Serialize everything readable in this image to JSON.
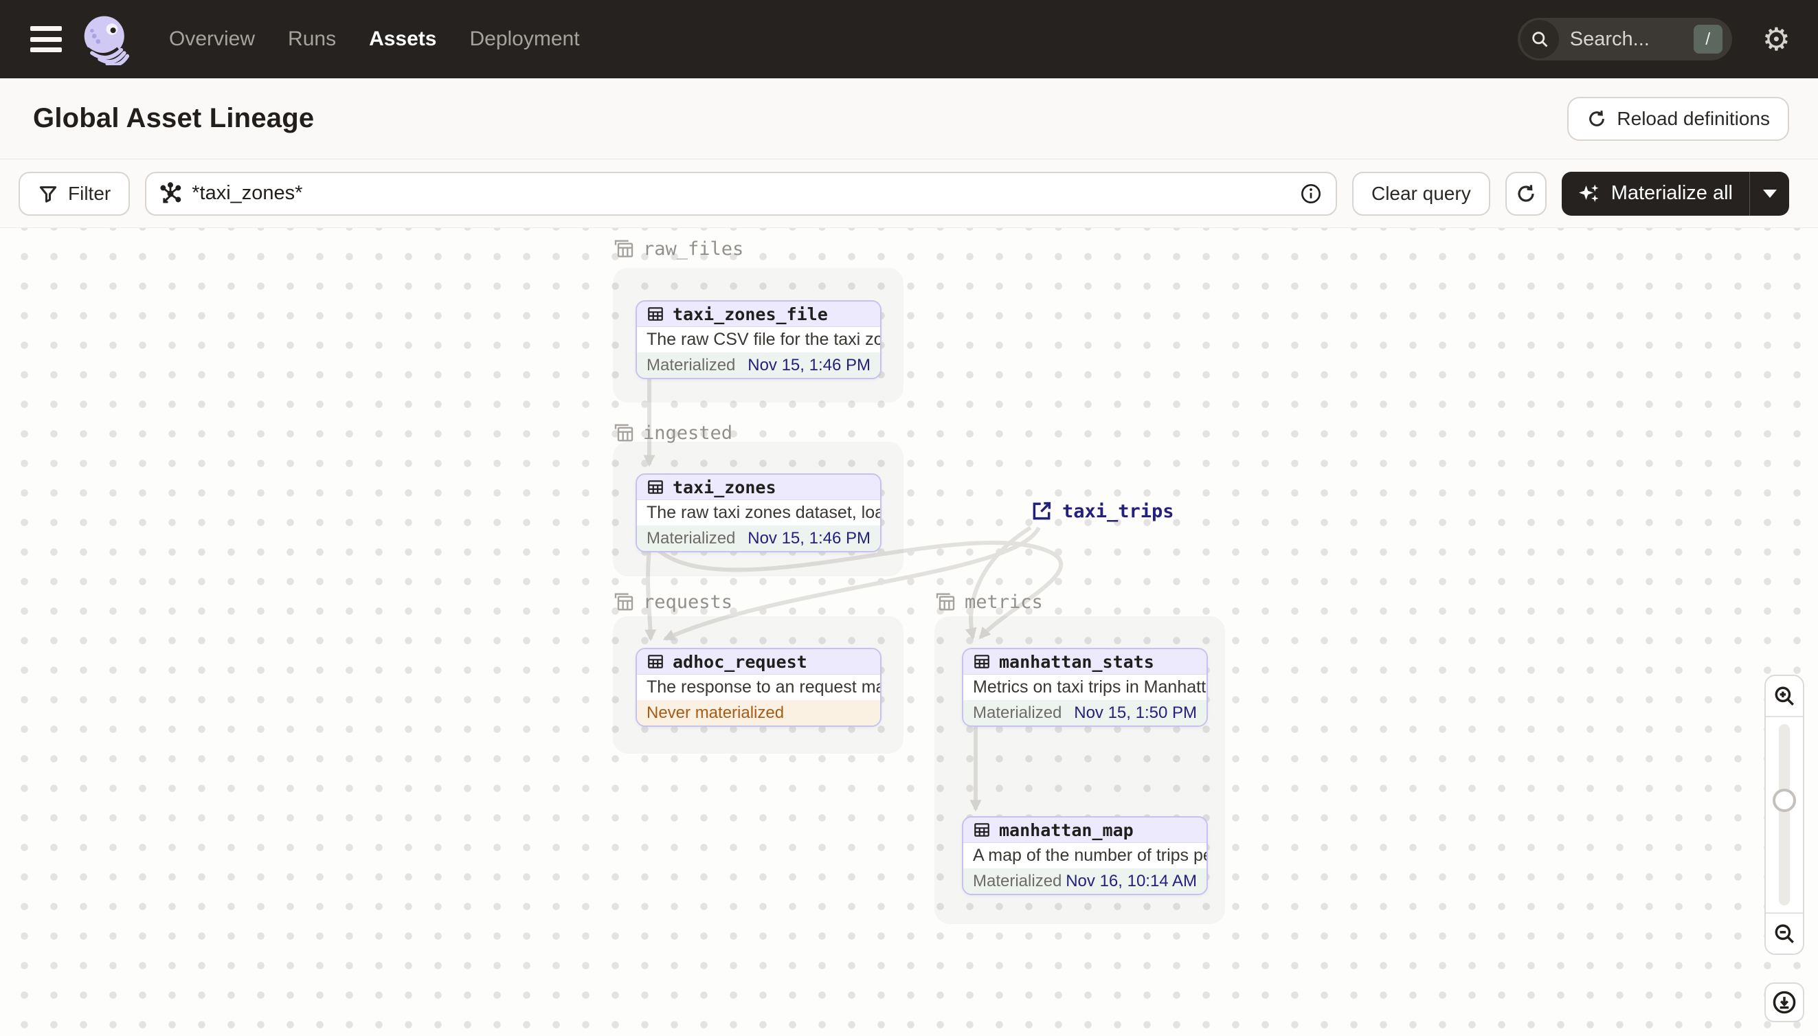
{
  "nav": {
    "items": {
      "overview": "Overview",
      "runs": "Runs",
      "assets": "Assets",
      "deployment": "Deployment"
    },
    "active_item": "Assets",
    "search_placeholder": "Search...",
    "search_shortcut": "/"
  },
  "header": {
    "title": "Global Asset Lineage",
    "reload_button": "Reload definitions"
  },
  "toolbar": {
    "filter_button": "Filter",
    "query_value": "*taxi_zones*",
    "clear_button": "Clear query",
    "materialize_button": "Materialize all"
  },
  "graph": {
    "groups": [
      "raw_files",
      "ingested",
      "requests",
      "metrics"
    ],
    "external_assets": [
      {
        "name": "taxi_trips"
      }
    ],
    "nodes": [
      {
        "name": "taxi_zones_file",
        "group": "raw_files",
        "description": "The raw CSV file for the taxi zones dat...",
        "status": "Materialized",
        "status_time": "Nov 15, 1:46 PM"
      },
      {
        "name": "taxi_zones",
        "group": "ingested",
        "description": "The raw taxi zones dataset, loaded int...",
        "status": "Materialized",
        "status_time": "Nov 15, 1:46 PM"
      },
      {
        "name": "adhoc_request",
        "group": "requests",
        "description": "The response to an request made in th...",
        "status": "Never materialized",
        "status_time": ""
      },
      {
        "name": "manhattan_stats",
        "group": "metrics",
        "description": "Metrics on taxi trips in Manhattan",
        "status": "Materialized",
        "status_time": "Nov 15, 1:50 PM"
      },
      {
        "name": "manhattan_map",
        "group": "metrics",
        "description": "A map of the number of trips per taxi z...",
        "status": "Materialized",
        "status_time": "Nov 16, 10:14 AM"
      }
    ],
    "edges": [
      [
        "taxi_zones_file",
        "taxi_zones"
      ],
      [
        "taxi_zones",
        "adhoc_request"
      ],
      [
        "taxi_zones",
        "manhattan_stats"
      ],
      [
        "taxi_trips",
        "adhoc_request"
      ],
      [
        "taxi_trips",
        "manhattan_stats"
      ],
      [
        "manhattan_stats",
        "manhattan_map"
      ]
    ]
  },
  "colors": {
    "nav_bg": "#262220",
    "accent_dark": "#262220",
    "node_border": "#c6c1f0",
    "node_header_bg": "#eceafc",
    "materialized_bg": "#edf3ee",
    "never_materialized_bg": "#faf1e3",
    "never_materialized_text": "#a85b16",
    "timestamp_text": "#23217c",
    "edge": "#e2e0dd"
  }
}
